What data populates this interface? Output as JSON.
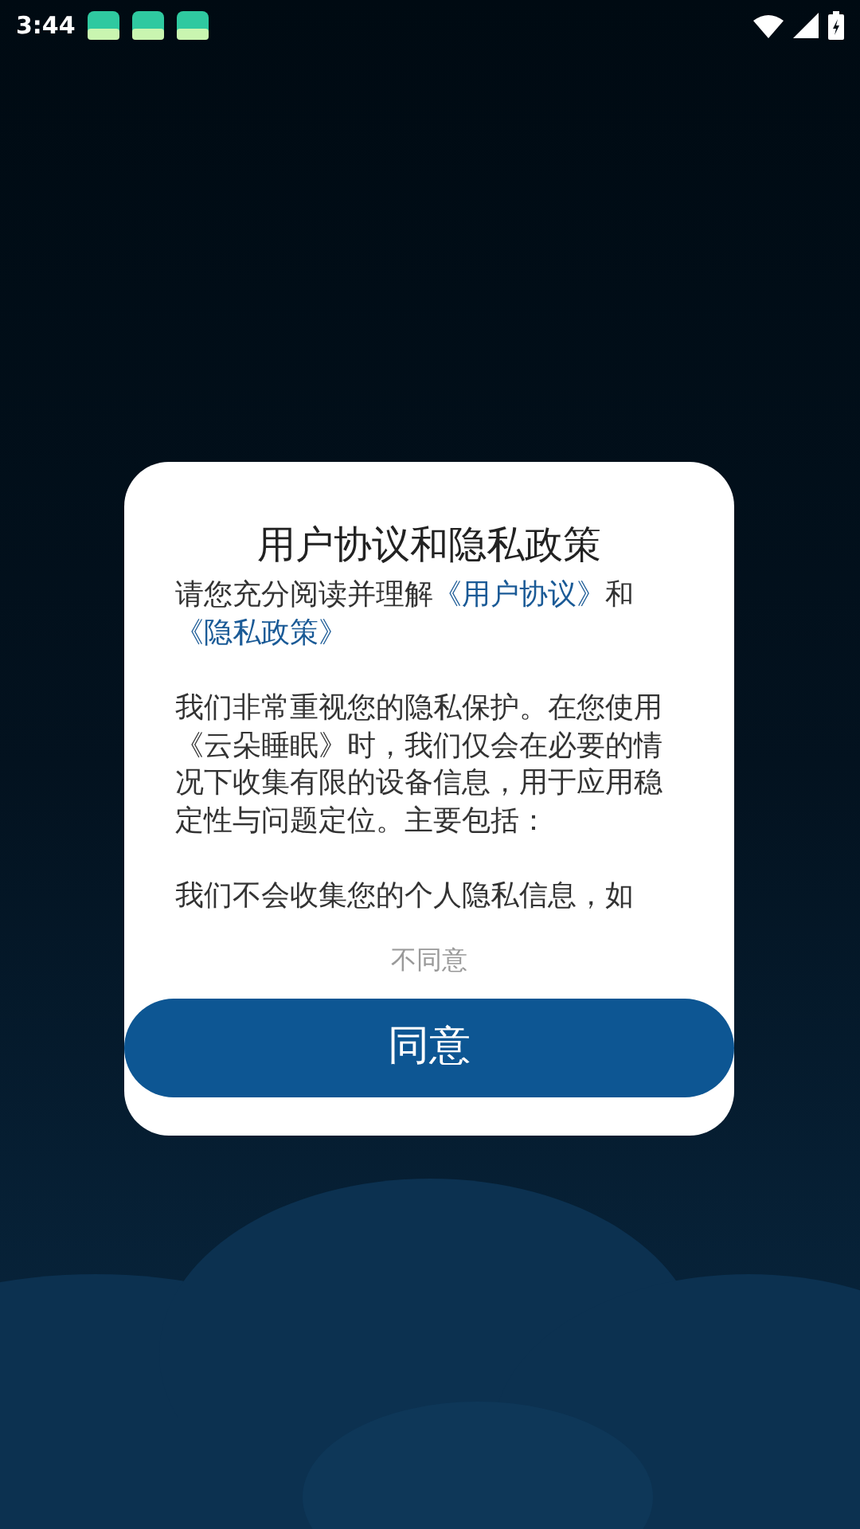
{
  "status_bar": {
    "time": "3:44"
  },
  "dialog": {
    "title": "用户协议和隐私政策",
    "intro": [
      {
        "kind": "plain",
        "text": "请您充分阅读并理解"
      },
      {
        "kind": "link",
        "text": "《用户协议》"
      },
      {
        "kind": "plain",
        "text": "和"
      },
      {
        "kind": "link",
        "text": "《隐私政策》"
      }
    ],
    "paragraphs": [
      "我们非常重视您的隐私保护。在您使用《云朵睡眠》时，我们仅会在必要的情况下收集有限的设备信息，用于应用稳定性与问题定位。主要包括：",
      "我们不会收集您的个人隐私信息，如"
    ],
    "decline": "不同意",
    "agree": "同意"
  }
}
